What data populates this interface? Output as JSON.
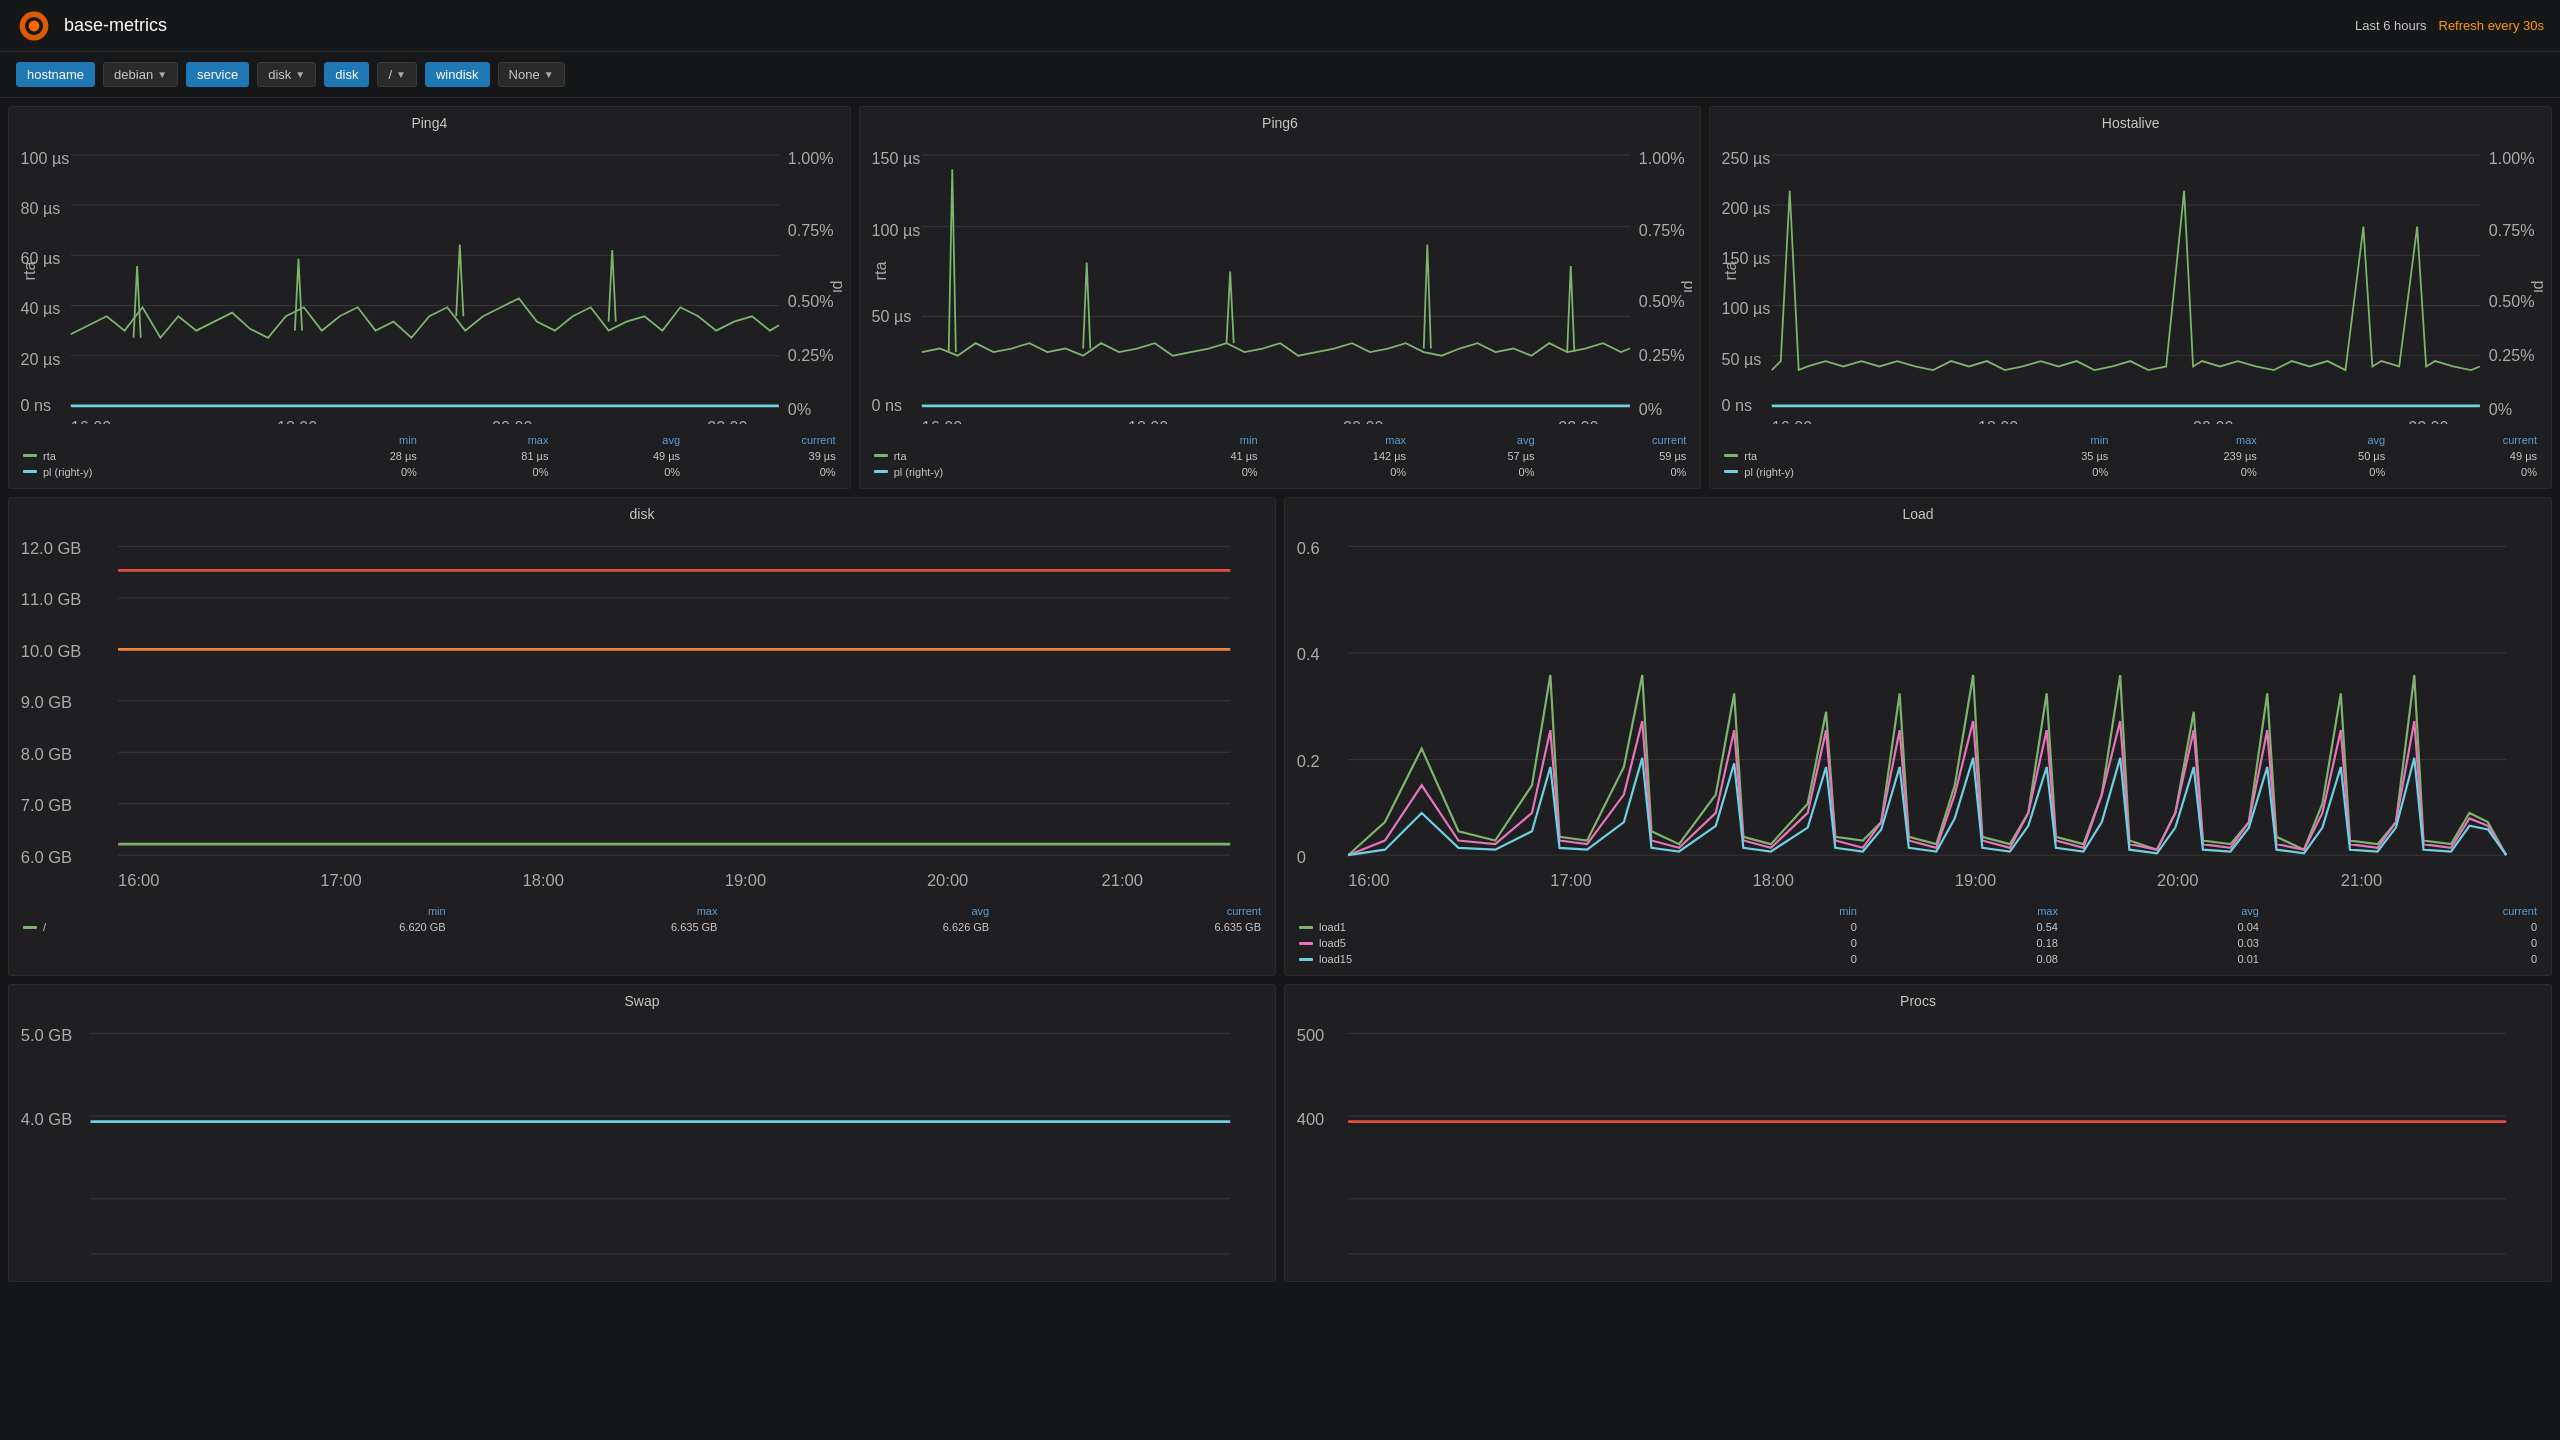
{
  "header": {
    "title": "base-metrics",
    "time_range": "Last 6 hours",
    "refresh": "Refresh every 30s"
  },
  "filters": [
    {
      "label": "hostname",
      "active": true,
      "has_dropdown": false
    },
    {
      "label": "debian",
      "active": false,
      "has_dropdown": true
    },
    {
      "label": "service",
      "active": true,
      "has_dropdown": false
    },
    {
      "label": "disk",
      "active": false,
      "has_dropdown": true
    },
    {
      "label": "disk",
      "active": true,
      "has_dropdown": false
    },
    {
      "label": "/",
      "active": false,
      "has_dropdown": true
    },
    {
      "label": "windisk",
      "active": true,
      "has_dropdown": false
    },
    {
      "label": "None",
      "active": false,
      "has_dropdown": true
    }
  ],
  "panels": {
    "ping4": {
      "title": "Ping4",
      "legend": {
        "headers": [
          "min",
          "max",
          "avg",
          "current"
        ],
        "rows": [
          {
            "name": "rta",
            "color": "green",
            "values": [
              "28 µs",
              "81 µs",
              "49 µs",
              "39 µs"
            ]
          },
          {
            "name": "pl (right-y)",
            "color": "blue",
            "values": [
              "0%",
              "0%",
              "0%",
              "0%"
            ]
          }
        ]
      }
    },
    "ping6": {
      "title": "Ping6",
      "legend": {
        "headers": [
          "min",
          "max",
          "avg",
          "current"
        ],
        "rows": [
          {
            "name": "rta",
            "color": "green",
            "values": [
              "41 µs",
              "142 µs",
              "57 µs",
              "59 µs"
            ]
          },
          {
            "name": "pl (right-y)",
            "color": "blue",
            "values": [
              "0%",
              "0%",
              "0%",
              "0%"
            ]
          }
        ]
      }
    },
    "hostalive": {
      "title": "Hostalive",
      "legend": {
        "headers": [
          "min",
          "max",
          "avg",
          "current"
        ],
        "rows": [
          {
            "name": "rta",
            "color": "green",
            "values": [
              "35 µs",
              "239 µs",
              "50 µs",
              "49 µs"
            ]
          },
          {
            "name": "pl (right-y)",
            "color": "blue",
            "values": [
              "0%",
              "0%",
              "0%",
              "0%"
            ]
          }
        ]
      }
    },
    "disk": {
      "title": "disk",
      "legend": {
        "headers": [
          "min",
          "max",
          "avg",
          "current"
        ],
        "rows": [
          {
            "name": "/",
            "color": "green",
            "values": [
              "6.620 GB",
              "6.635 GB",
              "6.626 GB",
              "6.635 GB"
            ]
          }
        ]
      }
    },
    "load": {
      "title": "Load",
      "legend": {
        "headers": [
          "min",
          "max",
          "avg",
          "current"
        ],
        "rows": [
          {
            "name": "load1",
            "color": "green",
            "values": [
              "0",
              "0.54",
              "0.04",
              "0"
            ]
          },
          {
            "name": "load5",
            "color": "pink",
            "values": [
              "0",
              "0.18",
              "0.03",
              "0"
            ]
          },
          {
            "name": "load15",
            "color": "blue",
            "values": [
              "0",
              "0.08",
              "0.01",
              "0"
            ]
          }
        ]
      }
    },
    "swap": {
      "title": "Swap"
    },
    "procs": {
      "title": "Procs"
    }
  }
}
